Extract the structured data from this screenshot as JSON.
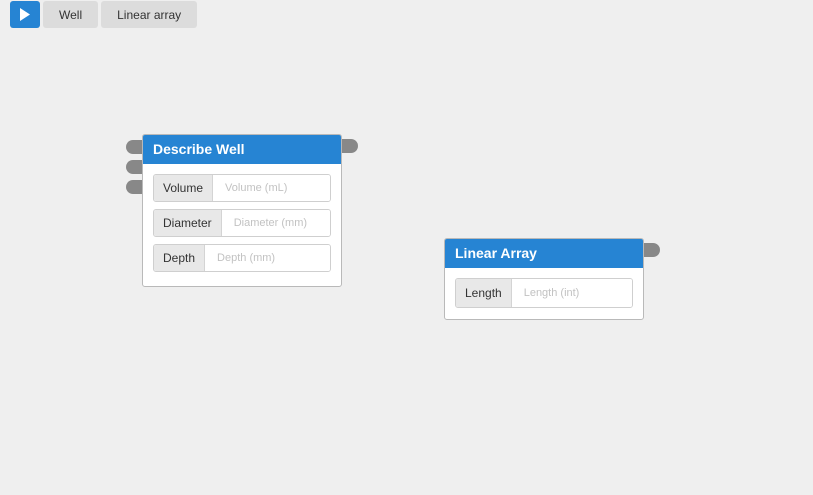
{
  "toolbar": {
    "run_icon": "play-icon",
    "buttons": [
      {
        "label": "Well"
      },
      {
        "label": "Linear array"
      }
    ]
  },
  "nodes": {
    "describe_well": {
      "title": "Describe Well",
      "fields": [
        {
          "label": "Volume",
          "placeholder": "Volume (mL)"
        },
        {
          "label": "Diameter",
          "placeholder": "Diameter (mm)"
        },
        {
          "label": "Depth",
          "placeholder": "Depth (mm)"
        }
      ]
    },
    "linear_array": {
      "title": "Linear Array",
      "fields": [
        {
          "label": "Length",
          "placeholder": "Length (int)"
        }
      ]
    }
  },
  "colors": {
    "accent": "#2684d3",
    "canvas": "#efefef",
    "port": "#888888"
  }
}
